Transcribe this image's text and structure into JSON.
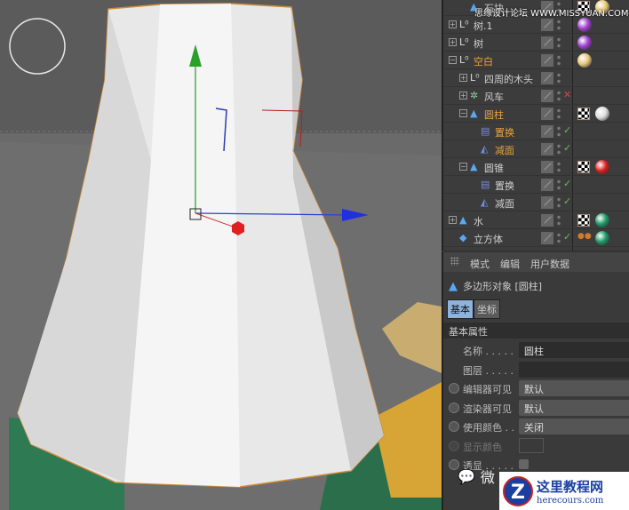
{
  "watermark_top": "思缘设计论坛 WWW.MISSYUAN.COM",
  "watermark_bottom": {
    "brand": "这里教程网",
    "url": "herecours.com",
    "wechat": "微"
  },
  "objects": [
    {
      "name": "石块",
      "indent": 1,
      "icon": "polygon-icon",
      "selected": false,
      "expand": false,
      "tags": [
        "checker",
        "sand"
      ]
    },
    {
      "name": "树.1",
      "indent": 0,
      "icon": "null-icon",
      "selected": false,
      "expand": true,
      "tags": [
        "purple"
      ]
    },
    {
      "name": "树",
      "indent": 0,
      "icon": "null-icon",
      "selected": false,
      "expand": true,
      "tags": [
        "purple"
      ]
    },
    {
      "name": "空白",
      "indent": 0,
      "icon": "null-icon",
      "selected": true,
      "expand": true,
      "tags": [
        "sand"
      ]
    },
    {
      "name": "四周的木头",
      "indent": 1,
      "icon": "null-icon",
      "selected": false,
      "expand": true,
      "tags": []
    },
    {
      "name": "风车",
      "indent": 1,
      "icon": "gear-icon",
      "selected": false,
      "expand": true,
      "tags": [],
      "x": true
    },
    {
      "name": "圆柱",
      "indent": 1,
      "icon": "polygon-icon",
      "selected": true,
      "expand": true,
      "tags": [
        "checker",
        "white"
      ]
    },
    {
      "name": "置换",
      "indent": 2,
      "icon": "displace-icon",
      "selected": true,
      "check": true,
      "tags": []
    },
    {
      "name": "减面",
      "indent": 2,
      "icon": "reduce-icon",
      "selected": true,
      "check": true,
      "tags": []
    },
    {
      "name": "圆锥",
      "indent": 1,
      "icon": "polygon-icon",
      "selected": false,
      "expand": true,
      "tags": [
        "checker",
        "red"
      ]
    },
    {
      "name": "置换",
      "indent": 2,
      "icon": "displace-icon",
      "selected": false,
      "check": true,
      "tags": []
    },
    {
      "name": "减面",
      "indent": 2,
      "icon": "reduce-icon",
      "selected": false,
      "check": true,
      "tags": []
    },
    {
      "name": "水",
      "indent": 0,
      "icon": "polygon-icon",
      "selected": false,
      "expand": true,
      "tags": [
        "checker",
        "green"
      ]
    },
    {
      "name": "立方体",
      "indent": 0,
      "icon": "cube-icon",
      "selected": false,
      "check": true,
      "tags": [
        "dots",
        "green"
      ]
    }
  ],
  "tag_colors": {
    "sand": "#e8c97a",
    "purple": "#a040d0",
    "white": "#dddddd",
    "red": "#dd2020",
    "green": "#1f9a6a"
  },
  "attr": {
    "menu": [
      "模式",
      "编辑",
      "用户数据"
    ],
    "object_title": "多边形对象 [圆柱]",
    "tabs": [
      "基本",
      "坐标"
    ],
    "section": "基本属性",
    "fields": [
      {
        "label": "名称 . . . . .",
        "value": "圆柱",
        "radio": false,
        "type": "text"
      },
      {
        "label": "图层 . . . . .",
        "value": "",
        "radio": false,
        "type": "text"
      },
      {
        "label": "编辑器可见",
        "value": "默认",
        "radio": true,
        "type": "select"
      },
      {
        "label": "渲染器可见",
        "value": "默认",
        "radio": true,
        "type": "select"
      },
      {
        "label": "使用颜色 . .",
        "value": "关闭",
        "radio": true,
        "type": "select"
      },
      {
        "label": "显示颜色",
        "value": "",
        "radio": true,
        "type": "color",
        "disabled": true
      },
      {
        "label": "透显 . . . . .",
        "value": "",
        "radio": true,
        "type": "checkbox"
      }
    ]
  }
}
